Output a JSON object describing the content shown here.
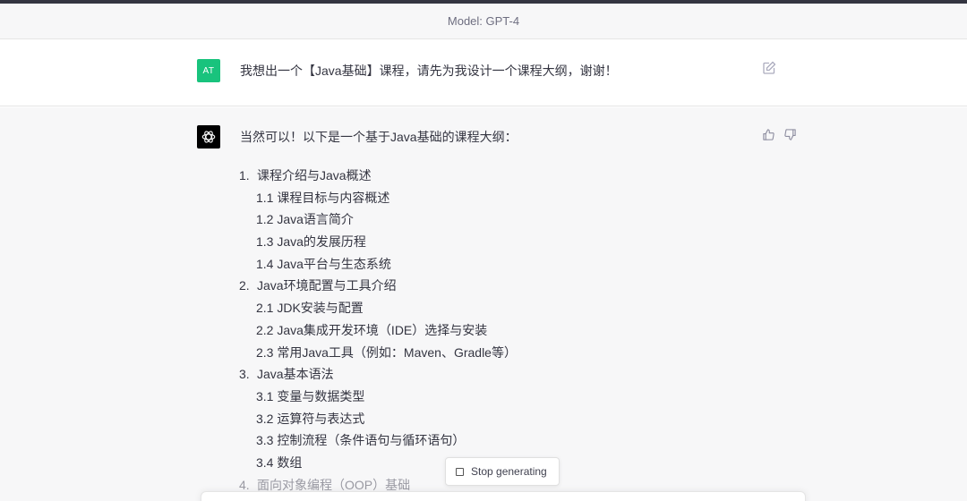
{
  "header": {
    "model_label": "Model: GPT-4"
  },
  "user_message": {
    "avatar_initials": "AT",
    "avatar_color": "#19c37d",
    "text": "我想出一个【Java基础】课程，请先为我设计一个课程大纲，谢谢！",
    "edit_icon": "edit-icon"
  },
  "assistant_message": {
    "avatar_icon": "openai-logo-icon",
    "intro": "当然可以！以下是一个基于Java基础的课程大纲：",
    "outline": [
      {
        "num": "1.",
        "text": "课程介绍与Java概述"
      },
      {
        "text": "1.1 课程目标与内容概述"
      },
      {
        "text": "1.2 Java语言简介"
      },
      {
        "text": "1.3 Java的发展历程"
      },
      {
        "text": "1.4 Java平台与生态系统"
      },
      {
        "num": "2.",
        "text": "Java环境配置与工具介绍"
      },
      {
        "text": "2.1 JDK安装与配置"
      },
      {
        "text": "2.2 Java集成开发环境（IDE）选择与安装"
      },
      {
        "text": "2.3 常用Java工具（例如：Maven、Gradle等）"
      },
      {
        "num": "3.",
        "text": "Java基本语法"
      },
      {
        "text": "3.1 变量与数据类型"
      },
      {
        "text": "3.2 运算符与表达式"
      },
      {
        "text": "3.3 控制流程（条件语句与循环语句）"
      },
      {
        "text": "3.4 数组"
      },
      {
        "num": "4.",
        "text": "面向对象编程（OOP）基础"
      }
    ],
    "thumbs_up_icon": "thumbs-up-icon",
    "thumbs_down_icon": "thumbs-down-icon"
  },
  "stop_button": {
    "label": "Stop generating"
  }
}
